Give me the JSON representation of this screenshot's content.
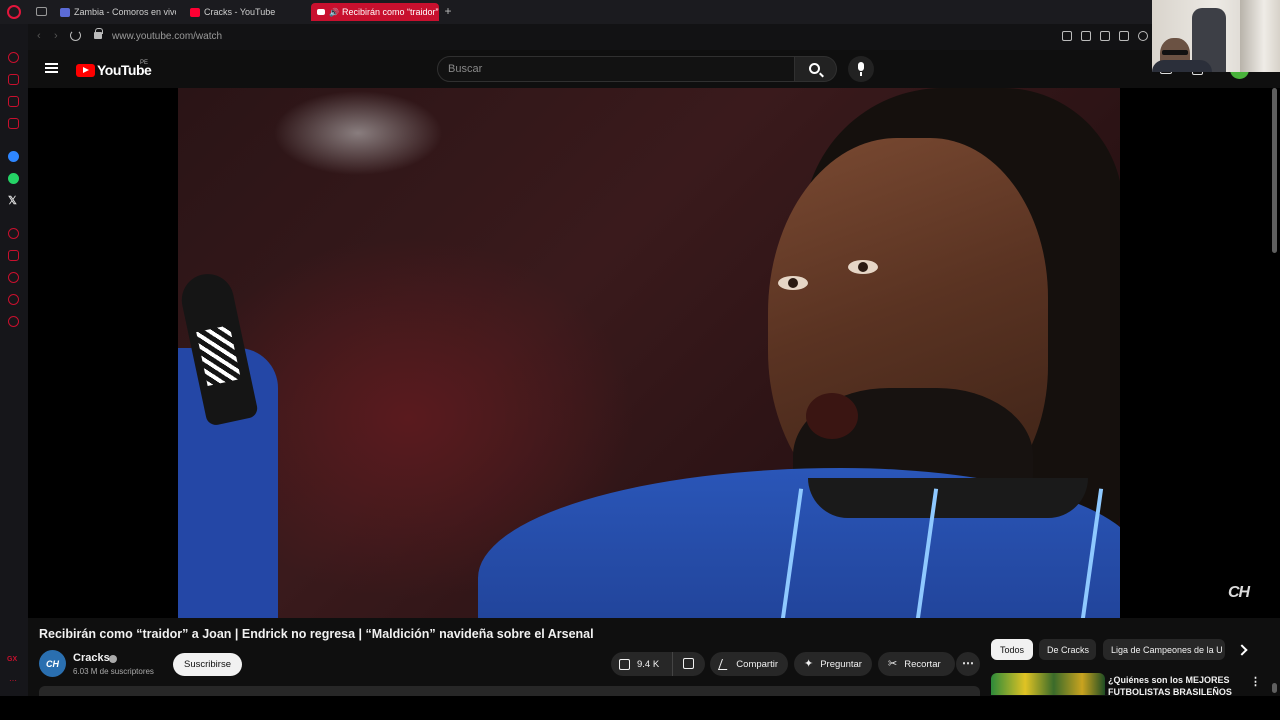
{
  "browser": {
    "tabs": [
      {
        "title": "Zambia - Comoros en vivo"
      },
      {
        "title": "Cracks - YouTube"
      },
      {
        "title": "Recibirán como “traidor” a Joan"
      }
    ],
    "new_tab_label": "+",
    "url": "www.youtube.com/watch"
  },
  "sidebar": {
    "x_label": "𝕏",
    "gx_label": "GX",
    "more_label": "⋯"
  },
  "masthead": {
    "logo_text": "YouTube",
    "country_code": "PE",
    "search_placeholder": "Buscar"
  },
  "player": {
    "watermark": "CH"
  },
  "video": {
    "title": "Recibirán como “traidor” a Joan | Endrick no regresa | “Maldición” navideña sobre el Arsenal",
    "channel_avatar": "CH",
    "channel_name": "Cracks",
    "subscribers": "6.03 M de suscriptores",
    "subscribe_label": "Suscribirse",
    "like_count": "9.4 K",
    "share_label": "Compartir",
    "ask_label": "Preguntar",
    "clip_label": "Recortar",
    "ask_icon": "✦",
    "clip_icon": "✂",
    "more_label": "⋯"
  },
  "chips": [
    {
      "label": "Todos"
    },
    {
      "label": "De Cracks"
    },
    {
      "label": "Liga de Campeones de la U"
    }
  ],
  "recommendation": {
    "title": "¿Quiénes son los MEJORES FUTBOLISTAS BRASILEÑOS d",
    "menu_label": "⋮"
  },
  "colors": {
    "accent": "#c8102e",
    "youtube_red": "#ff0000",
    "background": "#0f0f0f"
  }
}
